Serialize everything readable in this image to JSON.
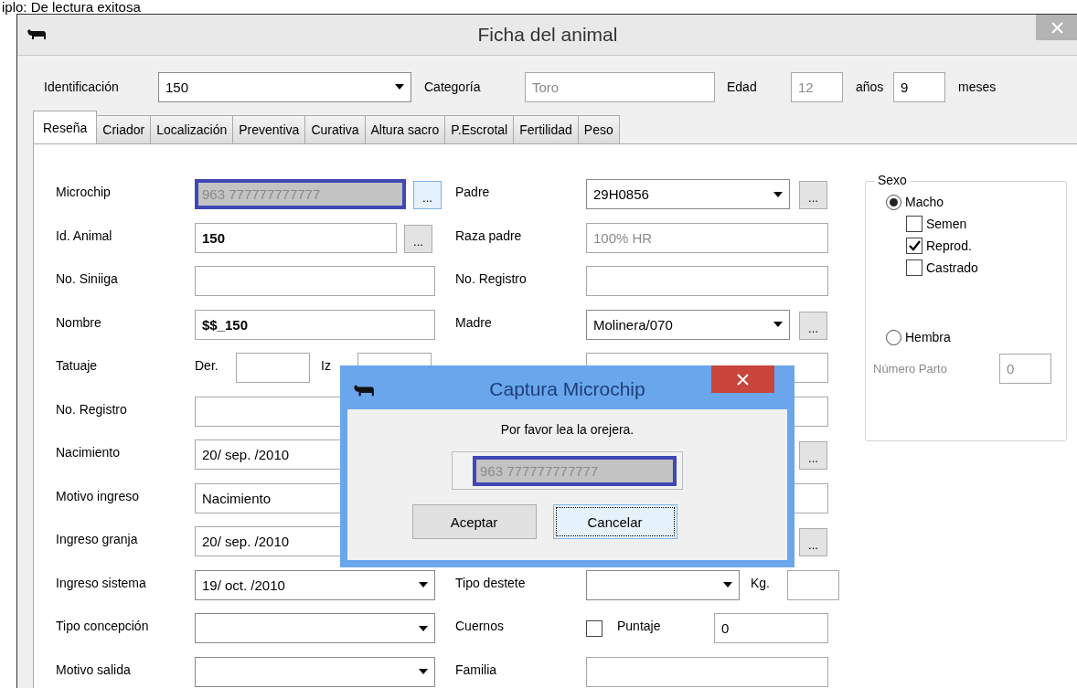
{
  "page_caption": "iplo: De lectura exitosa",
  "window": {
    "title": "Ficha del animal"
  },
  "header": {
    "identification": {
      "label": "Identificación",
      "value": "150"
    },
    "category": {
      "label": "Categoría",
      "value": "Toro"
    },
    "age": {
      "label": "Edad",
      "years": "12",
      "years_unit": "años",
      "months": "9",
      "months_unit": "meses"
    }
  },
  "tabs": [
    {
      "label": "Reseña",
      "selected": true
    },
    {
      "label": "Criador",
      "selected": false
    },
    {
      "label": "Localización",
      "selected": false
    },
    {
      "label": "Preventiva",
      "selected": false
    },
    {
      "label": "Curativa",
      "selected": false
    },
    {
      "label": "Altura sacro",
      "selected": false
    },
    {
      "label": "P.Escrotal",
      "selected": false
    },
    {
      "label": "Fertilidad",
      "selected": false
    },
    {
      "label": "Peso",
      "selected": false
    }
  ],
  "left_fields": [
    {
      "label": "Microchip",
      "kind": "picker",
      "value": "963 777777777777",
      "focused": true,
      "readonly": true,
      "button": "..."
    },
    {
      "label": "Id. Animal",
      "kind": "picker",
      "value": "150",
      "bold": true,
      "button": "..."
    },
    {
      "label": "No. Siniiga",
      "kind": "text"
    },
    {
      "label": "Nombre",
      "kind": "text",
      "value": "$$_150",
      "bold": true
    },
    {
      "label": "Tatuaje",
      "kind": "tattoo",
      "right_label": "Der.",
      "left_label": "Iz"
    },
    {
      "label": "No. Registro",
      "kind": "text"
    },
    {
      "label": "Nacimiento",
      "kind": "text",
      "value": "20/ sep. /2010"
    },
    {
      "label": "Motivo ingreso",
      "kind": "text",
      "value": "Nacimiento"
    },
    {
      "label": "Ingreso granja",
      "kind": "text",
      "value": "20/ sep. /2010"
    },
    {
      "label": "Ingreso sistema",
      "kind": "combo",
      "value": "19/ oct. /2010"
    },
    {
      "label": "Tipo concepción",
      "kind": "combo"
    },
    {
      "label": "Motivo salida",
      "kind": "combo"
    }
  ],
  "middle_fields": [
    {
      "label": "Padre",
      "kind": "combo_picker",
      "value": "29H0856",
      "button": "..."
    },
    {
      "label": "Raza padre",
      "kind": "text",
      "value": "100% HR",
      "readonly": true
    },
    {
      "label": "No. Registro",
      "kind": "text"
    },
    {
      "label": "Madre",
      "kind": "combo_picker",
      "value": "Molinera/070",
      "button": "..."
    },
    {
      "kind": "text"
    },
    {
      "kind": "text"
    },
    {
      "kind": "picker",
      "button": "..."
    },
    {
      "kind": "text"
    },
    {
      "kind": "picker",
      "button": "..."
    },
    {
      "label": "Tipo destete",
      "kind": "weaning",
      "unit": "Kg."
    },
    {
      "label": "Cuernos",
      "kind": "horns",
      "checked": false,
      "score_label": "Puntaje",
      "score": "0"
    },
    {
      "label": "Familia",
      "kind": "text"
    }
  ],
  "sex": {
    "title": "Sexo",
    "options": [
      {
        "label": "Macho",
        "selected": true,
        "flags": [
          {
            "label": "Semen",
            "checked": false
          },
          {
            "label": "Reprod.",
            "checked": true
          },
          {
            "label": "Castrado",
            "checked": false
          }
        ]
      },
      {
        "label": "Hembra",
        "selected": false
      }
    ],
    "births": {
      "label": "Número Parto",
      "value": "0",
      "disabled": true
    }
  },
  "dialog": {
    "title": "Captura Microchip",
    "message": "Por favor lea la orejera.",
    "value": "963 777777777777",
    "buttons": [
      {
        "label": "Aceptar",
        "focused": false
      },
      {
        "label": "Cancelar",
        "focused": true
      }
    ]
  }
}
